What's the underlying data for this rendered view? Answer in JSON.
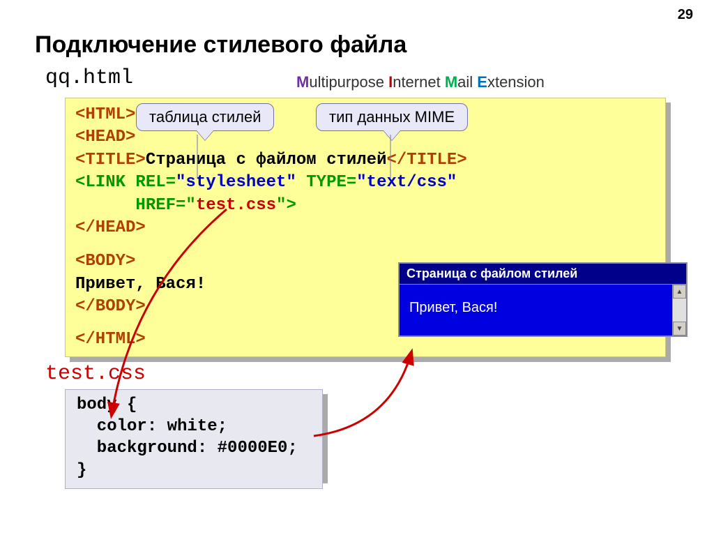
{
  "page_number": "29",
  "title": "Подключение стилевого файла",
  "html_filename": "qq.html",
  "mime": {
    "m_word": "M",
    "m_rest": "ultipurpose ",
    "i_word": "I",
    "i_rest": "nternet ",
    "ma_word": "M",
    "ma_rest": "ail ",
    "e_word": "E",
    "e_rest": "xtension"
  },
  "callout1": "таблица стилей",
  "callout2": "тип данных MIME",
  "code": {
    "l1": "<HTML>",
    "l2": "<HEAD>",
    "l3a": "<TITLE>",
    "l3b": "Страница с файлом стилей",
    "l3c": "</TITLE>",
    "l4a": "<LINK REL=",
    "l4b": "\"stylesheet\"",
    "l4c": " TYPE=",
    "l4d": "\"text/css\"",
    "l5a": "      HREF=\"",
    "l5b": "test.css",
    "l5c": "\">",
    "l6": "</HEAD>",
    "l7": "<BODY>",
    "l8": "Привет, Вася!",
    "l9": "</BODY>",
    "l10": "</HTML>"
  },
  "css_filename": "test.css",
  "css_code": {
    "l1": "body {",
    "l2": "  color: white;",
    "l3": "  background: #0000E0;",
    "l4": "}"
  },
  "browser": {
    "title": "Страница с файлом стилей",
    "body": "Привет, Вася!"
  }
}
